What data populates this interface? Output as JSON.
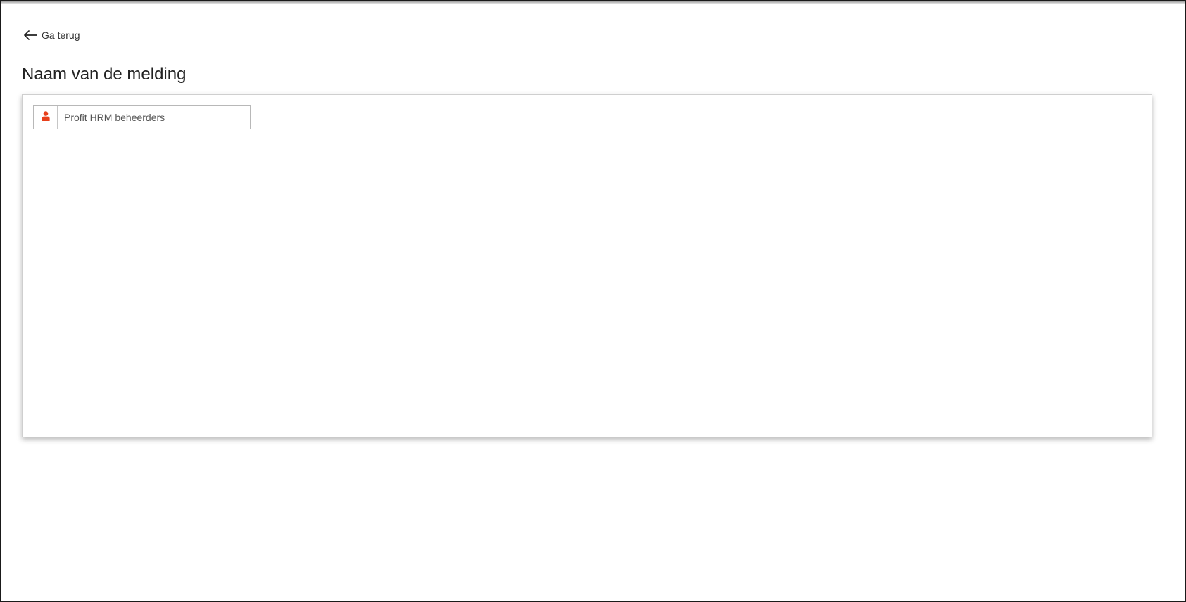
{
  "back": {
    "label": "Ga terug",
    "icon": "arrow-left-icon"
  },
  "page": {
    "title": "Naam van de melding"
  },
  "recipients": [
    {
      "label": "Profit HRM beheerders",
      "icon": "user-icon",
      "icon_color": "#e8401c"
    }
  ]
}
